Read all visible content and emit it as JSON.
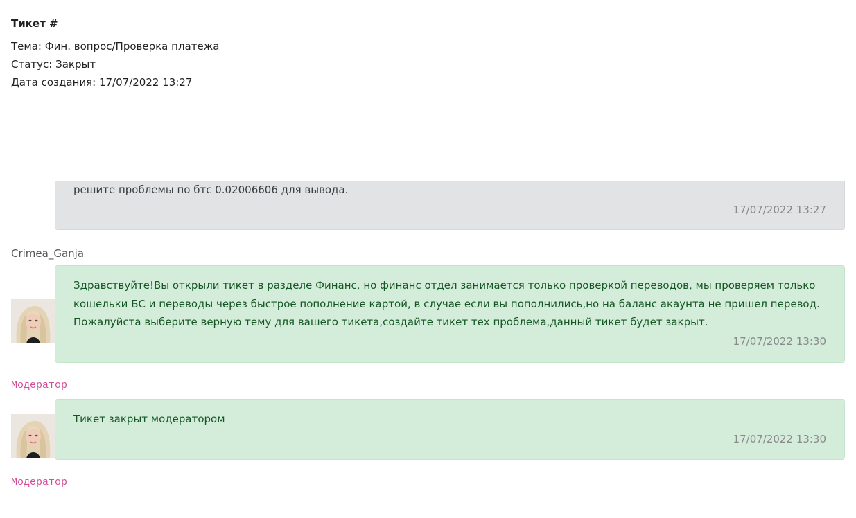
{
  "ticket": {
    "title": "Тикет #",
    "subject": "Тема: Фин. вопрос/Проверка платежа",
    "status": "Статус: Закрыт",
    "created": "Дата создания: 17/07/2022 13:27"
  },
  "messages": [
    {
      "text": "решите проблемы по бтс 0.02006606 для вывода.",
      "time": "17/07/2022 13:27",
      "author": "Crimea_Ganja"
    },
    {
      "text": "Здравствуйте!Вы открыли тикет в разделе Финанс, но финанс отдел занимается только проверкой переводов, мы проверяем только кошельки БС и переводы через быстрое пополнение картой, в случае если вы пополнились,но на баланс акаунта не пришел перевод. Пожалуйста выберите верную тему для вашего тикета,создайте тикет тех проблема,данный тикет будет закрыт.",
      "time": "17/07/2022 13:30",
      "author": "Модератор"
    },
    {
      "text": "Тикет закрыт модератором",
      "time": "17/07/2022 13:30",
      "author": "Модератор"
    }
  ],
  "colors": {
    "moderator_name": "#d24d99",
    "message_green_bg": "#d4edda",
    "message_gray_bg": "#e2e3e5",
    "message_green_text": "#155724"
  },
  "icons": {
    "avatar": "moderator-avatar-photo"
  }
}
